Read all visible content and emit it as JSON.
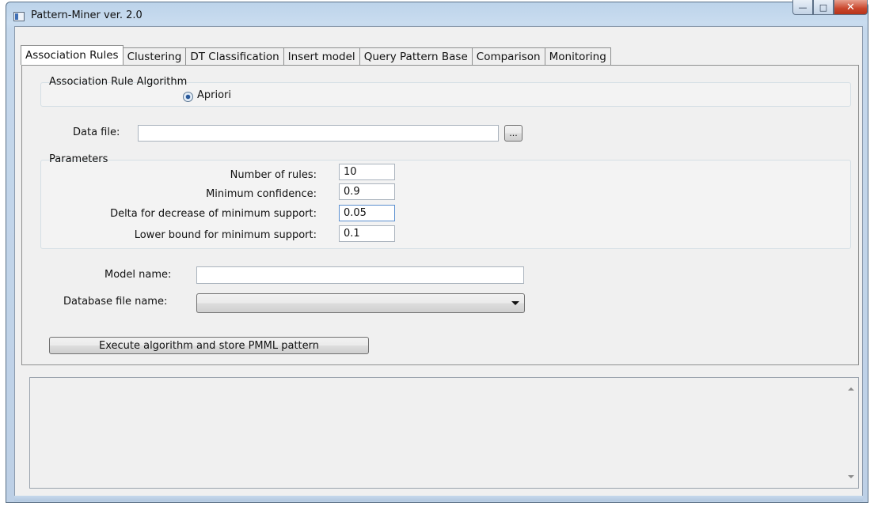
{
  "window": {
    "title": "Pattern-Miner ver. 2.0",
    "caption_buttons": {
      "minimize": "minimize-icon",
      "maximize": "maximize-icon",
      "close": "close-icon"
    }
  },
  "tabs": [
    {
      "label": "Association Rules",
      "active": true
    },
    {
      "label": "Clustering",
      "active": false
    },
    {
      "label": "DT Classification",
      "active": false
    },
    {
      "label": "Insert model",
      "active": false
    },
    {
      "label": "Query Pattern Base",
      "active": false
    },
    {
      "label": "Comparison",
      "active": false
    },
    {
      "label": "Monitoring",
      "active": false
    }
  ],
  "algorithm_group": {
    "title": "Association Rule Algorithm",
    "radio_label": "Apriori",
    "radio_checked": true
  },
  "data_file": {
    "label": "Data file:",
    "value": "",
    "browse_label": "..."
  },
  "parameters": {
    "title": "Parameters",
    "rows": [
      {
        "label": "Number of rules:",
        "value": "10"
      },
      {
        "label": "Minimum confidence:",
        "value": "0.9"
      },
      {
        "label": "Delta for decrease of minimum support:",
        "value": "0.05"
      },
      {
        "label": "Lower bound for minimum support:",
        "value": "0.1"
      }
    ]
  },
  "model_name": {
    "label": "Model name:",
    "value": ""
  },
  "database_file": {
    "label": "Database file name:",
    "selected": ""
  },
  "execute_button": {
    "label": "Execute algorithm and store PMML pattern"
  },
  "output": {
    "text": ""
  }
}
